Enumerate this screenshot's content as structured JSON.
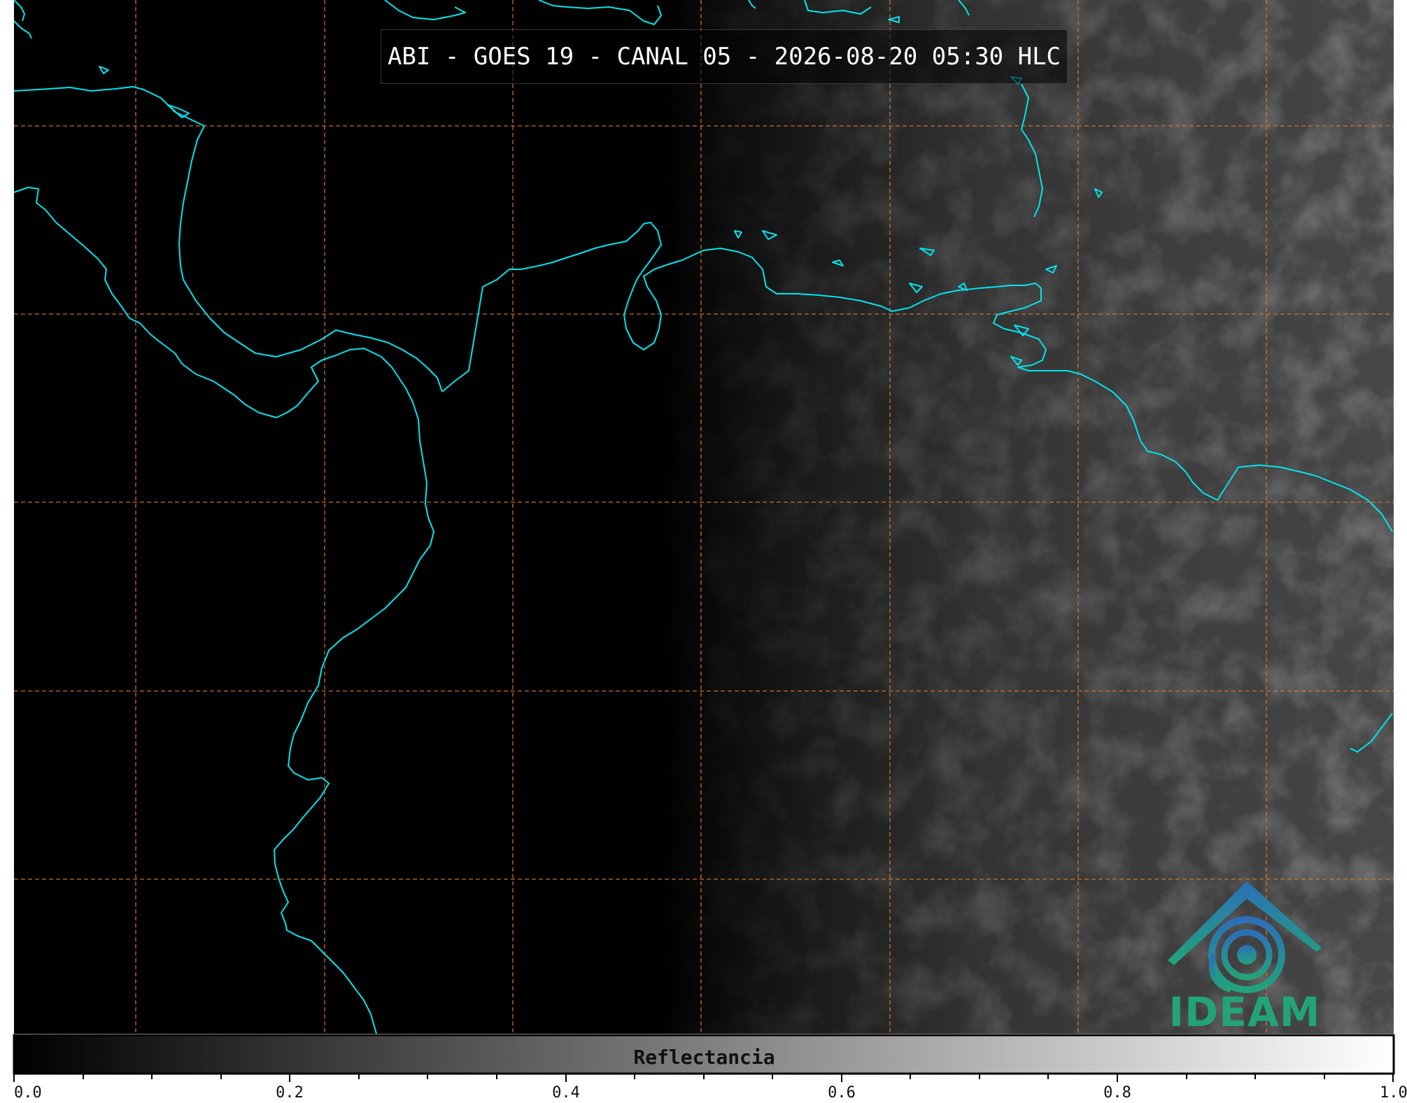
{
  "title": "ABI - GOES 19 - CANAL 05 - 2026-08-20 05:30 HLC",
  "logo": {
    "icon": "ideam-mountain-swirl-icon",
    "text": "IDEAM",
    "colors": [
      "#2c6fb8",
      "#22a37a"
    ]
  },
  "colorbar": {
    "label": "Reflectancia",
    "ticks": [
      "0.0",
      "0.2",
      "0.4",
      "0.6",
      "0.8",
      "1.0"
    ],
    "min": 0.0,
    "max": 1.0,
    "colormap": "grayscale"
  },
  "map": {
    "coastline_color": "#00e5ee",
    "grid_color": "#e07a2a",
    "grid_style": "dashed",
    "background": "#000000"
  }
}
